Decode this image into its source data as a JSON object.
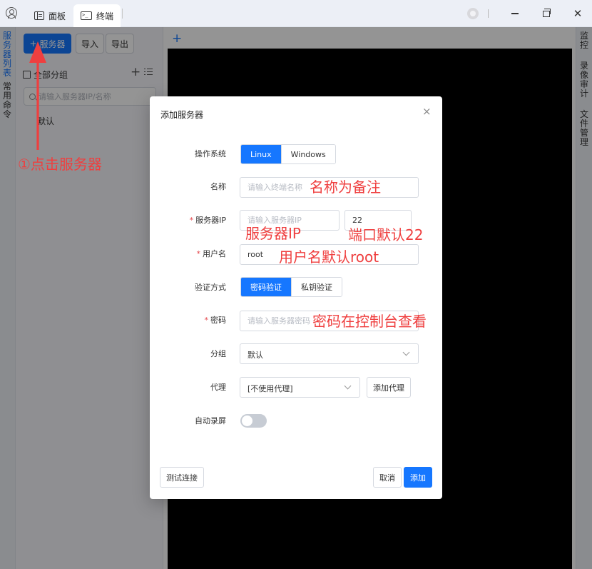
{
  "titlebar": {
    "tabs": [
      {
        "label": "面板",
        "icon": "panel-icon"
      },
      {
        "label": "终端",
        "icon": "terminal-icon"
      }
    ],
    "terminal_glyph": ">_"
  },
  "left_rail": {
    "servers_label": "服务器列表",
    "commands_label": "常用命令"
  },
  "server_panel": {
    "add_server_label": "服务器",
    "add_server_glyph": "+",
    "import_label": "导入",
    "export_label": "导出",
    "group_title": "全部分组",
    "search_placeholder": "请输入服务器IP/名称",
    "groups": [
      "默认"
    ]
  },
  "terminal": {
    "add_tab_glyph": "+"
  },
  "right_rail": {
    "monitor_label": "监控",
    "audit_label": "录像审计",
    "files_label": "文件管理"
  },
  "dialog": {
    "title": "添加服务器",
    "close_glyph": "×",
    "os_label": "操作系统",
    "os_options": [
      "Linux",
      "Windows"
    ],
    "os_selected": "Linux",
    "name_label": "名称",
    "name_placeholder": "请输入终端名称",
    "ip_label": "服务器IP",
    "ip_placeholder": "请输入服务器IP",
    "port_value": "22",
    "user_label": "用户名",
    "user_value": "root",
    "auth_label": "验证方式",
    "auth_options": [
      "密码验证",
      "私钥验证"
    ],
    "auth_selected": "密码验证",
    "password_label": "密码",
    "password_placeholder": "请输入服务器密码",
    "group_label": "分组",
    "group_value": "默认",
    "proxy_label": "代理",
    "proxy_value": "[不使用代理]",
    "add_proxy_label": "添加代理",
    "record_label": "自动录屏",
    "record_on": false,
    "test_button": "测试连接",
    "cancel_button": "取消",
    "submit_button": "添加"
  },
  "annotations": {
    "click_server": "①点击服务器",
    "name_note": "名称为备注",
    "ip_note": "服务器IP",
    "port_note": "端口默认22",
    "user_note": "用户名默认root",
    "password_note": "密码在控制台查看",
    "color": "#ef3f3f"
  },
  "colors": {
    "accent": "#1677ff",
    "annotation": "#ef3f3f"
  }
}
